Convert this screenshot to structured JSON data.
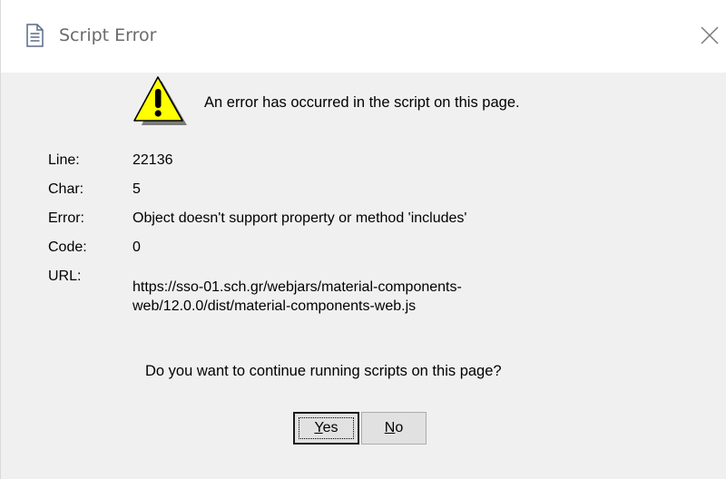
{
  "window": {
    "title": "Script Error",
    "title_icon": "document-icon",
    "close_icon": "close-icon"
  },
  "message": "An error has occurred in the script on this page.",
  "warning_icon": "warning-icon",
  "details": [
    {
      "label": "Line:",
      "value": "22136"
    },
    {
      "label": "Char:",
      "value": "5"
    },
    {
      "label": "Error:",
      "value": "Object doesn't support property or method 'includes'"
    },
    {
      "label": "Code:",
      "value": "0"
    },
    {
      "label": "URL:",
      "value": "https://sso-01.sch.gr/webjars/material-components-web/12.0.0/dist/material-components-web.js"
    }
  ],
  "url_display": {
    "line1": "https://sso-01.sch.gr/webjars/material-components-",
    "line2": "web/12.0.0/dist/material-components-web.js"
  },
  "question": "Do you want to continue running scripts on this page?",
  "buttons": {
    "yes": {
      "accel": "Y",
      "rest": "es"
    },
    "no": {
      "accel": "N",
      "rest": "o"
    }
  },
  "colors": {
    "dialog_bg": "#f0f0f0",
    "titlebar_bg": "#ffffff",
    "warning_fill": "#ffff00",
    "button_bg": "#e1e1e1"
  }
}
